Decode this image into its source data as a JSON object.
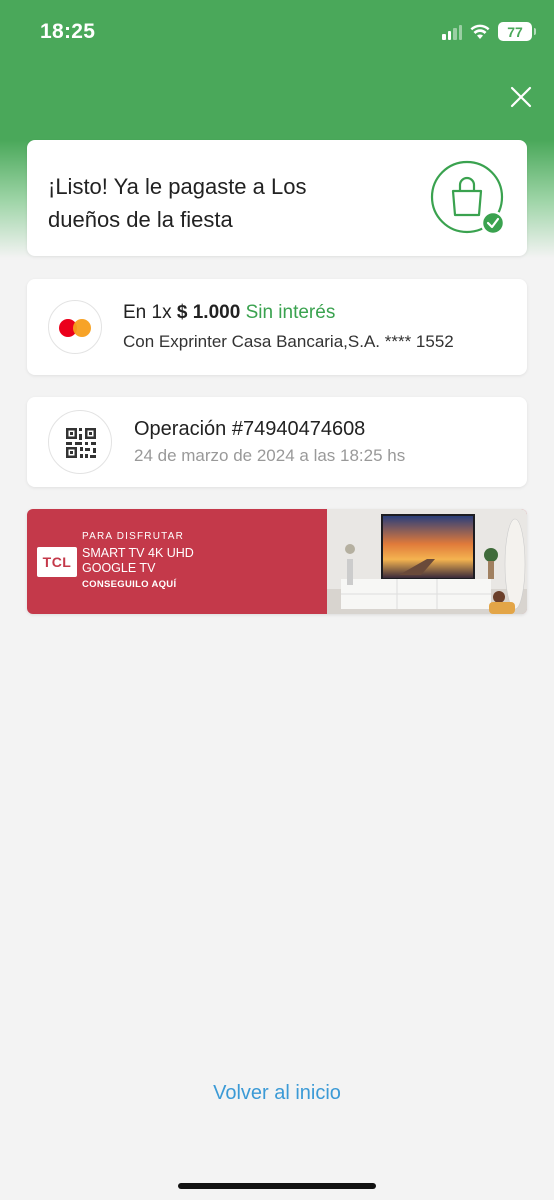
{
  "status_bar": {
    "time": "18:25",
    "battery": "77"
  },
  "success_card": {
    "title": "¡Listo! Ya le pagaste a Los dueños de la fiesta",
    "icon": "shopping-bag-check-icon"
  },
  "payment_card": {
    "installments": "En 1x",
    "amount": "$ 1.000",
    "interest": "Sin interés",
    "account": "Con Exprinter Casa Bancaria,S.A. **** 1552",
    "icon": "mastercard-logo"
  },
  "operation_card": {
    "title": "Operación #74940474608",
    "date": "24 de marzo de 2024 a las 18:25 hs",
    "icon": "qr-code-icon"
  },
  "banner": {
    "brand": "TCL",
    "kicker": "PARA DISFRUTAR",
    "line1": "SMART TV 4K UHD",
    "line2": "GOOGLE TV",
    "cta": "CONSEGUILO AQUÍ"
  },
  "footer": {
    "back_link": "Volver al inicio"
  },
  "colors": {
    "header_green": "#4aa85a",
    "success_green": "#3aa24f",
    "link_blue": "#3b9ad6",
    "banner_red": "#c4394a"
  }
}
